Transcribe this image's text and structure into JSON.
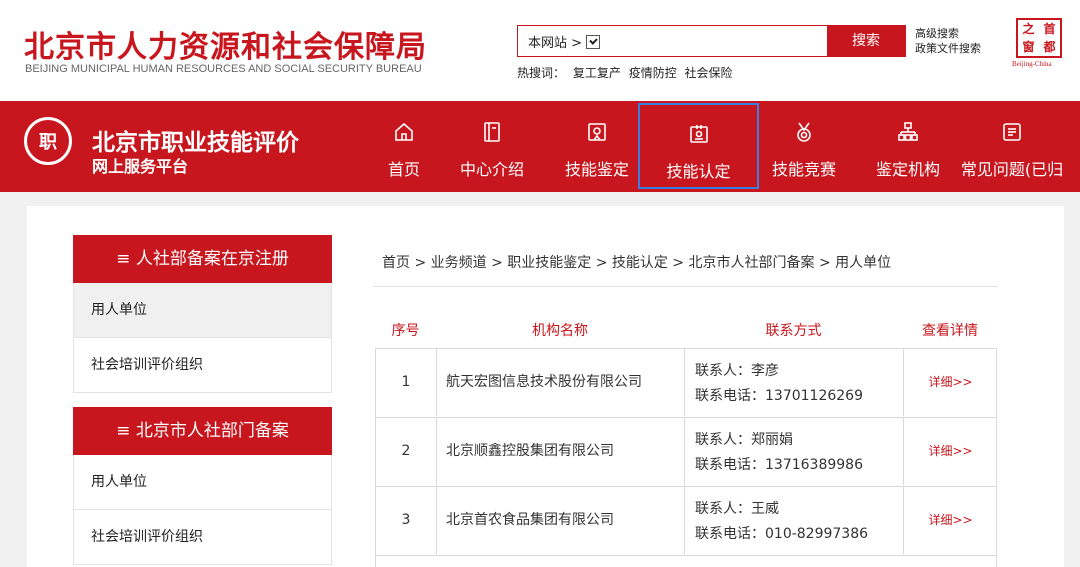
{
  "header": {
    "org_title": "北京市人力资源和社会保障局",
    "org_subtitle": "BEIJING MUNICIPAL HUMAN RESOURCES AND SOCIAL SECURITY BUREAU",
    "search": {
      "scope": "本网站 >",
      "button": "搜索",
      "advanced_search": "高级搜索",
      "policy_search": "政策文件搜索"
    },
    "hot_label": "热搜词：",
    "hot_terms": [
      "复工复产",
      "疫情防控",
      "社会保险"
    ],
    "emblem": {
      "chars": [
        "之",
        "首",
        "窗",
        "都"
      ],
      "caption": "Beijing-China"
    }
  },
  "navbar": {
    "logo_text": "职",
    "portal_title": "北京市职业技能评价",
    "portal_subtitle": "网上服务平台",
    "items": [
      {
        "label": "首页",
        "icon": "home-icon"
      },
      {
        "label": "中心介绍",
        "icon": "book-icon"
      },
      {
        "label": "技能鉴定",
        "icon": "certificate-icon"
      },
      {
        "label": "技能认定",
        "icon": "id-card-icon"
      },
      {
        "label": "技能竞赛",
        "icon": "medal-icon"
      },
      {
        "label": "鉴定机构",
        "icon": "org-chart-icon"
      },
      {
        "label": "常见问题(已归",
        "icon": "faq-icon"
      }
    ]
  },
  "sidebar": {
    "groups": [
      {
        "title": "≡ 人社部备案在京注册",
        "items": [
          "用人单位",
          "社会培训评价组织"
        ]
      },
      {
        "title": "≡ 北京市人社部门备案",
        "items": [
          "用人单位",
          "社会培训评价组织"
        ]
      }
    ]
  },
  "breadcrumb": "首页 > 业务频道 > 职业技能鉴定 > 技能认定 > 北京市人社部门备案 > 用人单位",
  "table": {
    "headers": {
      "no": "序号",
      "name": "机构名称",
      "contact": "联系方式",
      "detail": "查看详情"
    },
    "rows": [
      {
        "no": "1",
        "name": "航天宏图信息技术股份有限公司",
        "contact_person": "联系人：李彦",
        "contact_phone": "联系电话：13701126269",
        "detail": "详细>>"
      },
      {
        "no": "2",
        "name": "北京顺鑫控股集团有限公司",
        "contact_person": "联系人：郑丽娟",
        "contact_phone": "联系电话：13716389986",
        "detail": "详细>>"
      },
      {
        "no": "3",
        "name": "北京首农食品集团有限公司",
        "contact_person": "联系人：王威",
        "contact_phone": "联系电话：010-82997386",
        "detail": "详细>>"
      }
    ]
  }
}
